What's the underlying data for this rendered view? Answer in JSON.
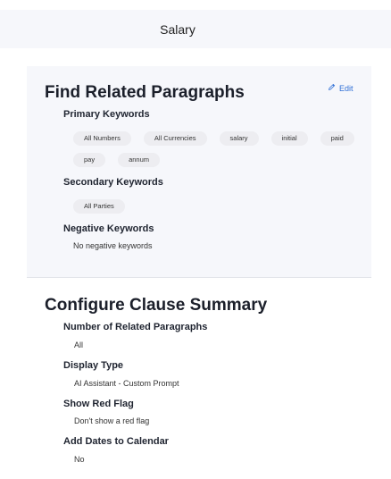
{
  "header": {
    "title": "Salary"
  },
  "find_section": {
    "title": "Find Related Paragraphs",
    "edit_label": "Edit",
    "primary": {
      "label": "Primary Keywords",
      "chips": [
        "All Numbers",
        "All Currencies",
        "salary",
        "initial",
        "paid",
        "pay",
        "annum"
      ]
    },
    "secondary": {
      "label": "Secondary Keywords",
      "chips": [
        "All Parties"
      ]
    },
    "negative": {
      "label": "Negative Keywords",
      "value": "No negative keywords"
    }
  },
  "configure_section": {
    "title": "Configure Clause Summary",
    "fields": [
      {
        "label": "Number of Related Paragraphs",
        "value": "All"
      },
      {
        "label": "Display Type",
        "value": "AI Assistant - Custom Prompt"
      },
      {
        "label": "Show Red Flag",
        "value": "Don't show a red flag"
      },
      {
        "label": "Add Dates to Calendar",
        "value": "No"
      }
    ]
  },
  "colors": {
    "accent": "#2f6fd6",
    "panel_bg": "#f6f7fb",
    "chip_bg": "#ededf1"
  },
  "icons": {
    "edit": "pencil-icon"
  }
}
